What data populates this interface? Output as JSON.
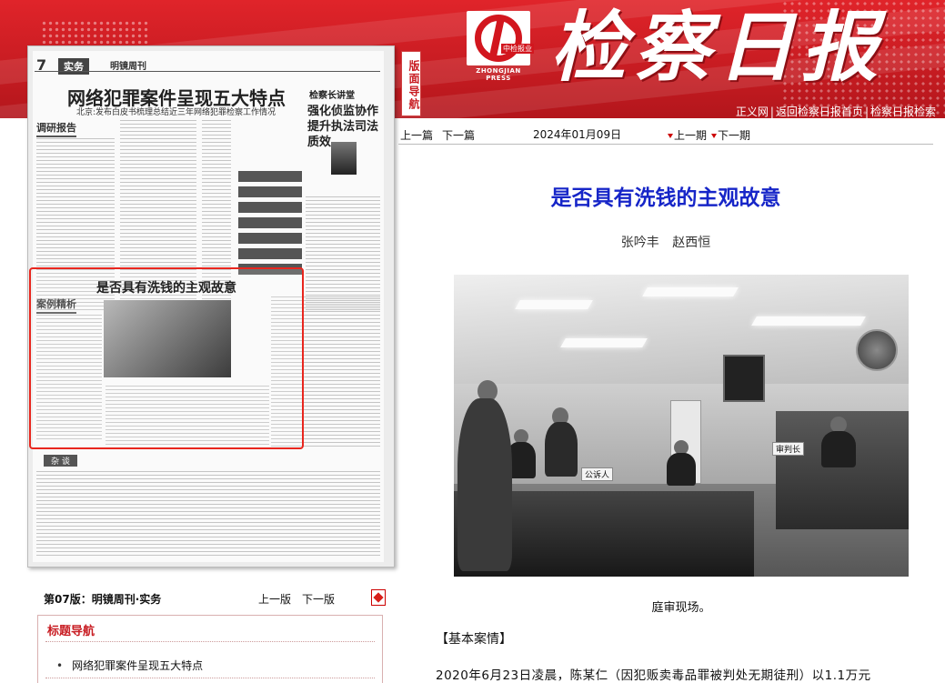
{
  "header": {
    "masthead": "检察日报",
    "logo_press": "ZHONGJIAN PRESS",
    "logo_cn": "中检报业",
    "links": [
      "正义网",
      "返回检察日报首页",
      "检察日报检索"
    ]
  },
  "vertical_nav": "版面导航",
  "paper_preview": {
    "page_no": "7",
    "section": "实务",
    "weekly": "明镜周刊",
    "headline_top": "网络犯罪案件呈现五大特点",
    "subhead_top": "北京:发布白皮书梳理总结近三年网络犯罪检察工作情况",
    "column_tag_right": "检察长讲堂",
    "right_title": "强化侦监协作提升执法司法质效",
    "tag_research": "调研报告",
    "tag_case": "案例精析",
    "highlight_title": "是否具有洗钱的主观故意",
    "foot_tag": "杂 谈"
  },
  "article_nav": {
    "prev_article": "上一篇",
    "next_article": "下一篇",
    "date": "2024年01月09日",
    "prev_issue": "上一期",
    "next_issue": "下一期"
  },
  "article": {
    "title": "是否具有洗钱的主观故意",
    "authors": "张吟丰 赵西恒",
    "caption": "庭审现场。",
    "section_head": "【基本案情】",
    "body_first_line": "2020年6月23日凌晨，陈某仁（因犯贩卖毒品罪被判处无期徒刑）以1.1万元"
  },
  "photo_labels": {
    "left_plate": "公诉人",
    "right_plate": "审判长"
  },
  "page_nav": {
    "page_title": "第07版：明镜周刊·实务",
    "prev_page": "上一版",
    "next_page": "下一版"
  },
  "topics": {
    "heading": "标题导航",
    "items": [
      "网络犯罪案件呈现五大特点"
    ]
  },
  "colors": {
    "banner_red": "#c81c22",
    "title_blue": "#1726c8",
    "highlight_red": "#e8261e"
  }
}
